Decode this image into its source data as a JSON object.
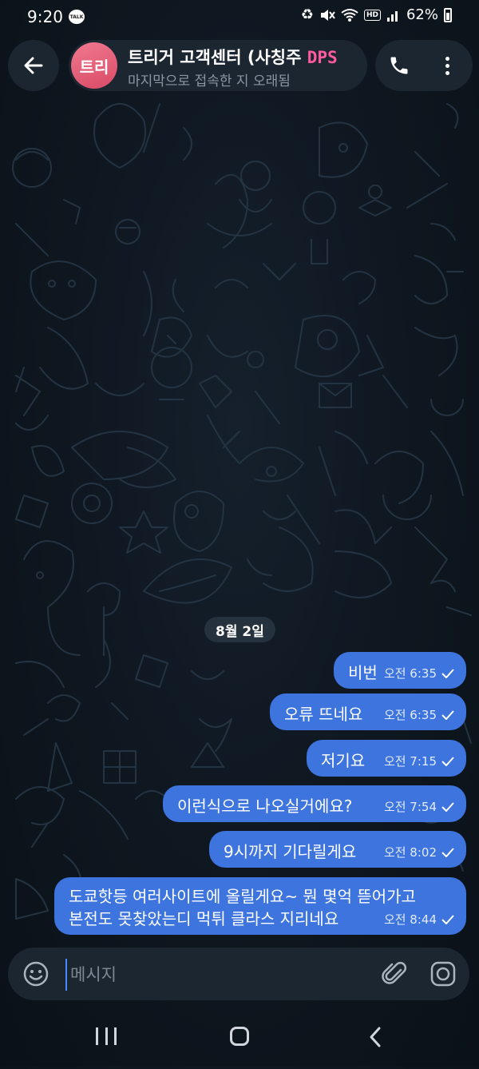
{
  "status_bar": {
    "time": "9:20",
    "talk_badge": "TALK",
    "hd": "HD",
    "battery": "62%"
  },
  "header": {
    "avatar_initials": "트리",
    "chat_name": "트리거 고객센터 (사칭주",
    "chat_name_tag": "DPS",
    "chat_status": "마지막으로 접속한 지 오래됨"
  },
  "date_chip": "8월 2일",
  "messages": [
    {
      "text": "비번",
      "time": "오전 6:35"
    },
    {
      "text": "오류 뜨네요",
      "time": "오전 6:35"
    },
    {
      "text": "저기요",
      "time": "오전 7:15"
    },
    {
      "text": "이런식으로 나오실거에요?",
      "time": "오전 7:54"
    },
    {
      "text": "9시까지 기다릴게요",
      "time": "오전 8:02"
    },
    {
      "lines": [
        "도쿄핫등 여러사이트에 올릴게요~ 뭔 몇억 뜯어가고",
        "본전도 못찾았는디 먹튀 클라스 지리네요"
      ],
      "time": "오전 8:44"
    }
  ],
  "composer": {
    "placeholder": "메시지"
  },
  "colors": {
    "bubble": "#3d74de",
    "avatar": "#e45f79",
    "background": "#101820"
  }
}
